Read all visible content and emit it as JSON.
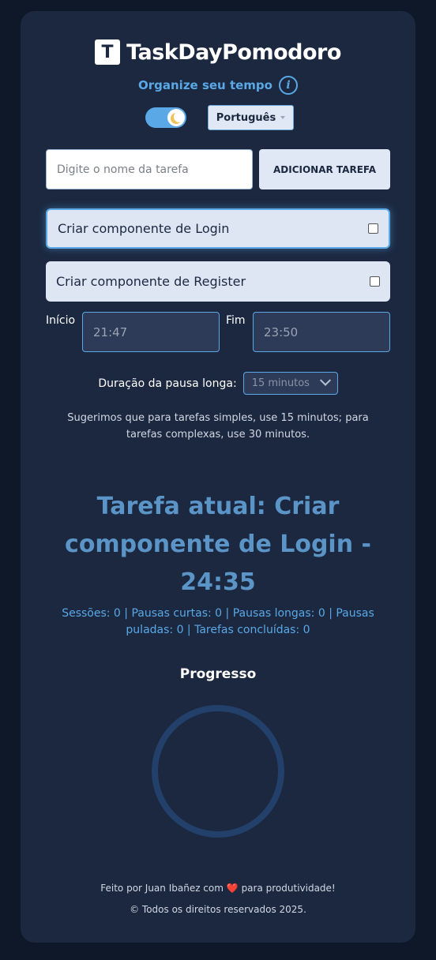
{
  "header": {
    "logo_letter": "T",
    "title": "TaskDayPomodoro",
    "subtitle": "Organize seu tempo",
    "info_glyph": "i"
  },
  "controls": {
    "theme_toggle": {
      "state": "on",
      "icon": "moon-icon"
    },
    "language": "Português"
  },
  "task_form": {
    "placeholder": "Digite o nome da tarefa",
    "add_label": "ADICIONAR TAREFA"
  },
  "tasks": [
    {
      "label": "Criar componente de Login",
      "checked": false,
      "active": true
    },
    {
      "label": "Criar componente de Register",
      "checked": false,
      "active": false
    }
  ],
  "schedule": {
    "start_label": "Início",
    "start_value": "21:47",
    "end_label": "Fim",
    "end_value": "23:50"
  },
  "long_pause": {
    "label": "Duração da pausa longa:",
    "value": "15 minutos"
  },
  "hint": "Sugerimos que para tarefas simples, use 15 minutos; para tarefas complexas, use 30 minutos.",
  "current_task": "Tarefa atual: Criar componente de Login - 24:35",
  "stats": "Sessões: 0 | Pausas curtas: 0 | Pausas longas: 0 | Pausas puladas: 0 | Tarefas concluídas: 0",
  "progress": {
    "title": "Progresso",
    "value": 0
  },
  "footer": {
    "credit_prefix": "Feito por Juan Ibañez com",
    "heart": "❤️",
    "credit_suffix": "para produtividade!",
    "copyright": "© Todos os direitos reservados 2025."
  },
  "colors": {
    "background": "#0f1829",
    "card": "#1b2840",
    "accent": "#5aa8e6",
    "current_task": "#5b95c8"
  }
}
